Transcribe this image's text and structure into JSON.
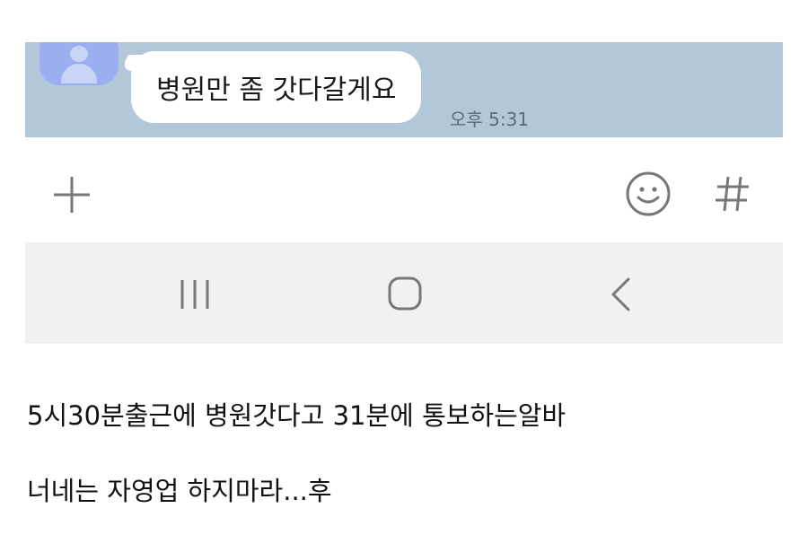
{
  "chat": {
    "message": "병원만 좀 갓다갈게요",
    "timestamp": "오후 5:31"
  },
  "input_bar": {
    "icons": [
      "plus-icon",
      "emoji-icon",
      "hash-icon"
    ]
  },
  "nav_bar": {
    "icons": [
      "recents-icon",
      "home-icon",
      "back-icon"
    ]
  },
  "captions": [
    "5시30분출근에 병원갓다고 31분에 통보하는알바",
    "너네는 자영업 하지마라...후"
  ],
  "colors": {
    "chat_background": "#b2c7da",
    "avatar": "#9baff0",
    "nav_background": "#f1f1f1",
    "icon_gray": "#777777"
  }
}
